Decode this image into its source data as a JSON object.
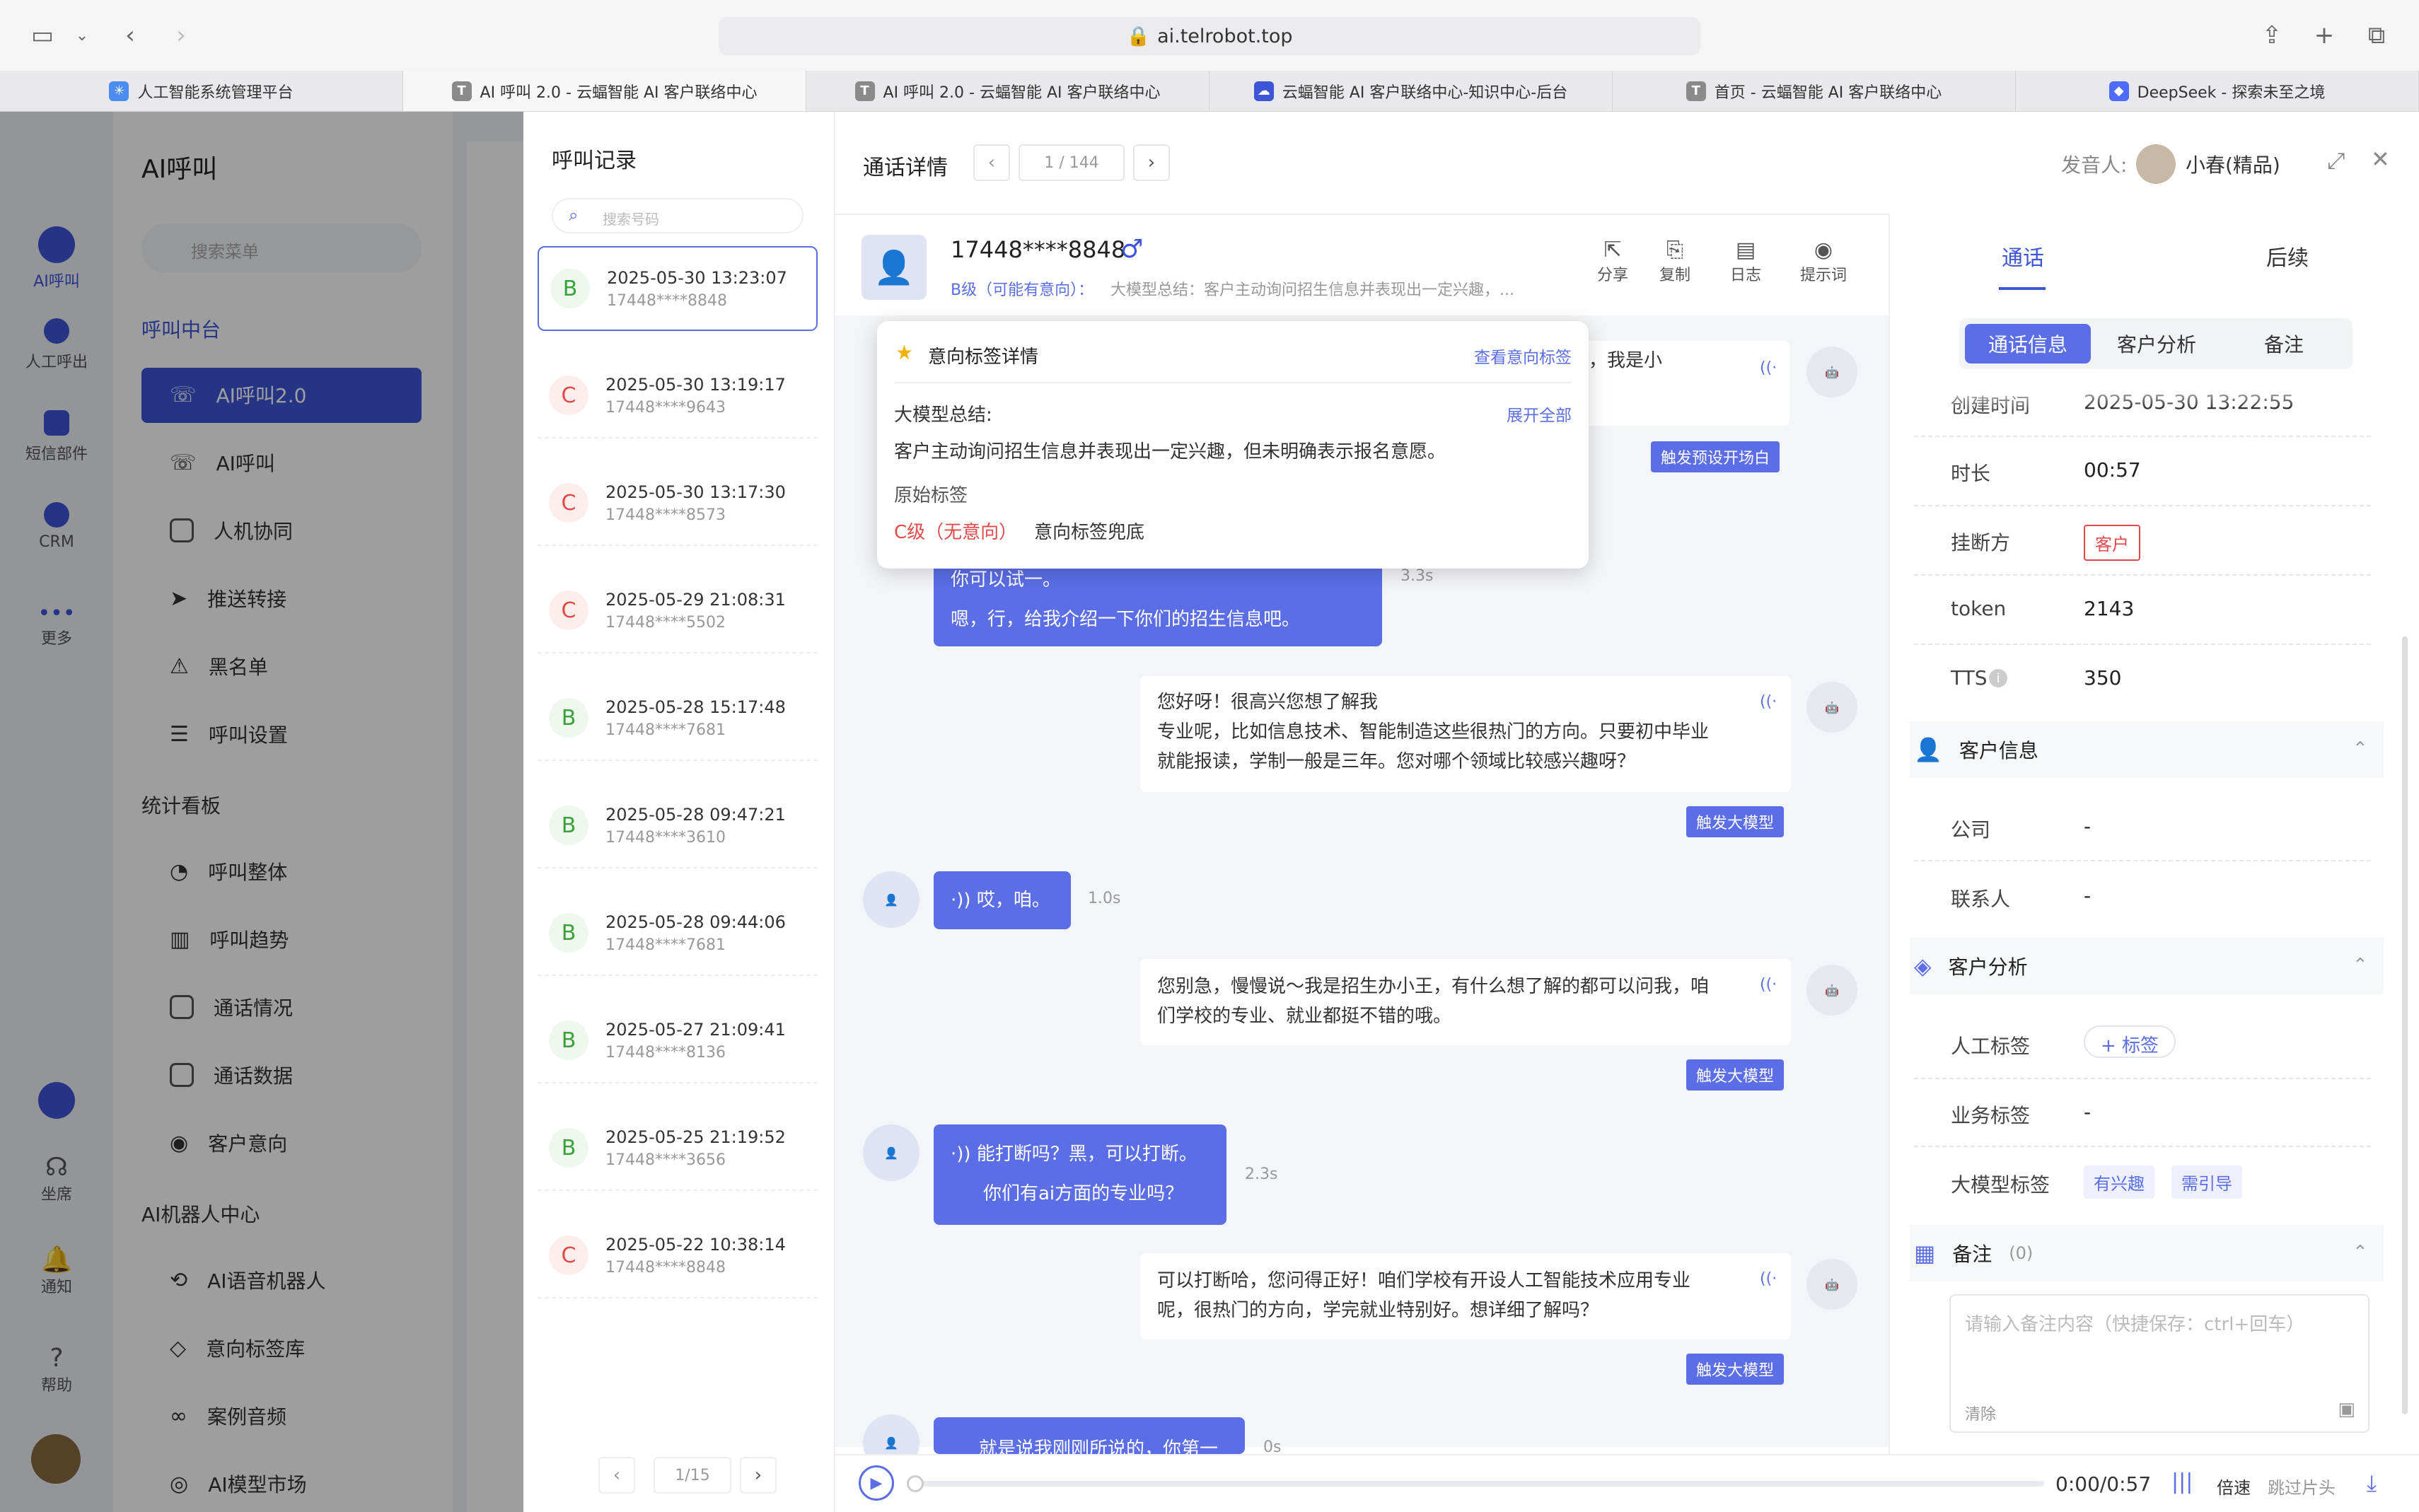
{
  "browser": {
    "url": "ai.telrobot.top"
  },
  "tabs": [
    {
      "label": "人工智能系统管理平台"
    },
    {
      "label": "AI 呼叫 2.0 - 云蝠智能 AI 客户联络中心"
    },
    {
      "label": "AI 呼叫 2.0 - 云蝠智能 AI 客户联络中心"
    },
    {
      "label": "云蝠智能 AI 客户联络中心-知识中心-后台"
    },
    {
      "label": "首页 - 云蝠智能 AI 客户联络中心"
    },
    {
      "label": "DeepSeek - 探索未至之境"
    }
  ],
  "rail": {
    "items": [
      "AI呼叫",
      "人工呼出",
      "短信部件",
      "CRM",
      "更多",
      "坐席",
      "通知",
      "帮助"
    ]
  },
  "sidebar": {
    "title": "AI呼叫",
    "search_placeholder": "搜索菜单",
    "group1": "呼叫中台",
    "items1": [
      "AI呼叫2.0",
      "AI呼叫",
      "人机协同",
      "推送转接",
      "黑名单",
      "呼叫设置"
    ],
    "group2": "统计看板",
    "items2": [
      "呼叫整体",
      "呼叫趋势",
      "通话情况",
      "通话数据",
      "客户意向"
    ],
    "group3": "AI机器人中心",
    "items3": [
      "AI语音机器人",
      "意向标签库",
      "案例音频",
      "AI模型市场"
    ]
  },
  "records": {
    "title": "呼叫记录",
    "search_placeholder": "搜索号码",
    "items": [
      {
        "grade": "B",
        "time": "2025-05-30 13:23:07",
        "phone": "17448****8848"
      },
      {
        "grade": "C",
        "time": "2025-05-30 13:19:17",
        "phone": "17448****9643"
      },
      {
        "grade": "C",
        "time": "2025-05-30 13:17:30",
        "phone": "17448****8573"
      },
      {
        "grade": "C",
        "time": "2025-05-29 21:08:31",
        "phone": "17448****5502"
      },
      {
        "grade": "B",
        "time": "2025-05-28 15:17:48",
        "phone": "17448****7681"
      },
      {
        "grade": "B",
        "time": "2025-05-28 09:47:21",
        "phone": "17448****3610"
      },
      {
        "grade": "B",
        "time": "2025-05-28 09:44:06",
        "phone": "17448****7681"
      },
      {
        "grade": "B",
        "time": "2025-05-27 21:09:41",
        "phone": "17448****8136"
      },
      {
        "grade": "B",
        "time": "2025-05-25 21:19:52",
        "phone": "17448****3656"
      },
      {
        "grade": "C",
        "time": "2025-05-22 10:38:14",
        "phone": "17448****8848"
      }
    ],
    "pager": "1/15"
  },
  "detail": {
    "title": "通话详情",
    "pager": "1 / 144",
    "speaker_label": "发音人:",
    "speaker": "小春(精品)",
    "phone": "17448****8848",
    "grade_text": "B级（可能有意向）：",
    "summary_short": "大模型总结：客户主动询问招生信息并表现出一定兴趣，...",
    "actions": [
      "分享",
      "复制",
      "日志",
      "提示词"
    ]
  },
  "popup": {
    "title": "意向标签详情",
    "link": "查看意向标签",
    "summary_label": "大模型总结:",
    "expand": "展开全部",
    "summary": "客户主动询问招生信息并表现出一定兴趣，但未明确表示报名意愿。",
    "orig_label": "原始标签",
    "orig_tag": "C级（无意向）",
    "orig_note": "意向标签兜底"
  },
  "chat": {
    "m0_tail": "生办，我是小",
    "trig0": "触发预设开场白",
    "m1_a": "你可以试一。",
    "m1_b": "嗯，行，给我介绍一下你们的招生信息吧。",
    "m1_delay": "3.3s",
    "m2_a": "您好呀！很高兴您想了解我",
    "m2_b": "专业呢，比如信息技术、智能制造这些很热门的方向。只要初中毕业",
    "m2_c": "就能报读，学制一般是三年。您对哪个领域比较感兴趣呀？",
    "trig2": "触发大模型",
    "m3": "哎，咱。",
    "m3_delay": "1.0s",
    "m4_a": "您别急，慢慢说～我是招生办小王，有什么想了解的都可以问我，咱",
    "m4_b": "们学校的专业、就业都挺不错的哦。",
    "trig4": "触发大模型",
    "m5_a": "能打断吗？黑，可以打断。",
    "m5_b": "你们有ai方面的专业吗？",
    "m5_delay": "2.3s",
    "m6_a": "可以打断哈，您问得正好！咱们学校有开设人工智能技术应用专业",
    "m6_b": "呢，很热门的方向，学完就业特别好。想详细了解吗？",
    "trig6": "触发大模型",
    "m7": "就是说我刚刚所说的，你第一",
    "m7_delay": "0s"
  },
  "player": {
    "time": "0:00/0:57",
    "speed": "倍速",
    "skip": "跳过片头"
  },
  "right": {
    "tabs": [
      "通话",
      "后续"
    ],
    "subtabs": [
      "通话信息",
      "客户分析",
      "备注"
    ],
    "created_label": "创建时间",
    "created": "2025-05-30 13:22:55",
    "duration_label": "时长",
    "duration": "00:57",
    "hangup_label": "挂断方",
    "hangup": "客户",
    "token_label": "token",
    "token": "2143",
    "tts_label": "TTS",
    "tts": "350",
    "cust_info": "客户信息",
    "company_label": "公司",
    "company": "-",
    "contact_label": "联系人",
    "contact": "-",
    "cust_analysis": "客户分析",
    "manual_label": "人工标签",
    "add_tag": "+ 标签",
    "biz_label": "业务标签",
    "biz": "-",
    "llm_label": "大模型标签",
    "llm_tags": [
      "有兴趣",
      "需引导"
    ],
    "note": "备注",
    "note_count": "(0)",
    "note_placeholder": "请输入备注内容（快捷保存：ctrl+回车）",
    "clear": "清除"
  },
  "colors": {
    "accent": "#5b6ee6",
    "danger": "#e24a4a",
    "success": "#3aa23a"
  }
}
